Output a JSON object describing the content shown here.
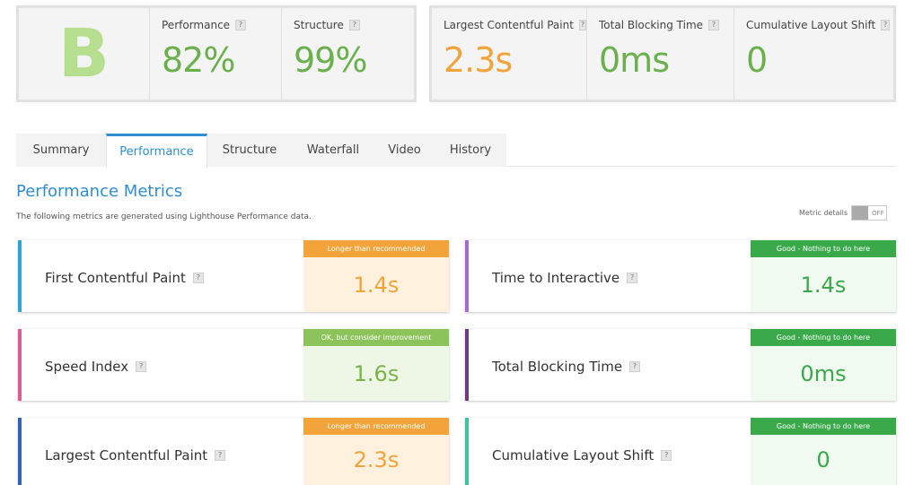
{
  "summary": {
    "grade": "B",
    "scores": [
      {
        "label": "Performance",
        "value": "82%",
        "color": "#6ab04c"
      },
      {
        "label": "Structure",
        "value": "99%",
        "color": "#6ab04c"
      }
    ],
    "vitals": [
      {
        "label": "Largest Contentful Paint",
        "value": "2.3s",
        "color": "#f2a33a"
      },
      {
        "label": "Total Blocking Time",
        "value": "0ms",
        "color": "#6ab04c"
      },
      {
        "label": "Cumulative Layout Shift",
        "value": "0",
        "color": "#6ab04c"
      }
    ],
    "help_glyph": "?"
  },
  "tabs": [
    {
      "label": "Summary",
      "active": false
    },
    {
      "label": "Performance",
      "active": true
    },
    {
      "label": "Structure",
      "active": false
    },
    {
      "label": "Waterfall",
      "active": false
    },
    {
      "label": "Video",
      "active": false
    },
    {
      "label": "History",
      "active": false
    }
  ],
  "section": {
    "title": "Performance Metrics",
    "description": "The following metrics are generated using Lighthouse Performance data.",
    "metric_details_label": "Metric details",
    "toggle_state": "OFF"
  },
  "metrics": [
    {
      "name": "First Contentful Paint",
      "status": "Longer than recommended",
      "value": "1.4s",
      "accent": "#2aa7d9",
      "status_color": "#f2a33a",
      "value_bg": "#fff1de",
      "value_color": "#f2a33a"
    },
    {
      "name": "Time to Interactive",
      "status": "Good - Nothing to do here",
      "value": "1.4s",
      "accent": "#a66bc8",
      "status_color": "#3aa94a",
      "value_bg": "#f0faf0",
      "value_color": "#3aa94a"
    },
    {
      "name": "Speed Index",
      "status": "OK, but consider improvement",
      "value": "1.6s",
      "accent": "#e15a94",
      "status_color": "#8cc35a",
      "value_bg": "#eef7e6",
      "value_color": "#7bb24a"
    },
    {
      "name": "Total Blocking Time",
      "status": "Good - Nothing to do here",
      "value": "0ms",
      "accent": "#6f3a7e",
      "status_color": "#3aa94a",
      "value_bg": "#f0faf0",
      "value_color": "#3aa94a"
    },
    {
      "name": "Largest Contentful Paint",
      "status": "Longer than recommended",
      "value": "2.3s",
      "accent": "#2f63b5",
      "status_color": "#f2a33a",
      "value_bg": "#fff1de",
      "value_color": "#f2a33a"
    },
    {
      "name": "Cumulative Layout Shift",
      "status": "Good - Nothing to do here",
      "value": "0",
      "accent": "#3cc4a0",
      "status_color": "#3aa94a",
      "value_bg": "#f0faf0",
      "value_color": "#3aa94a"
    }
  ]
}
